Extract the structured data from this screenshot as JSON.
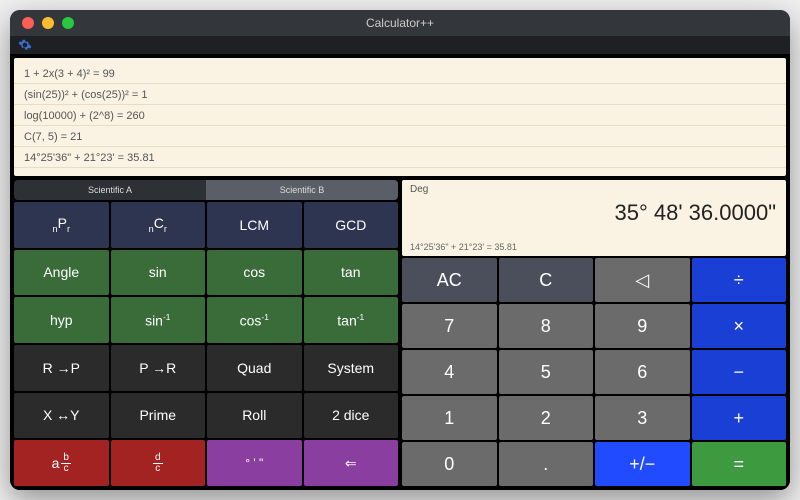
{
  "window": {
    "title": "Calculator++"
  },
  "history": [
    "1 + 2x(3 + 4)² = 99",
    "(sin(25))² + (cos(25))² = 1",
    "log(10000) + (2^8) = 260",
    "C(7, 5) = 21",
    "14°25'36\" + 21°23' = 35.81"
  ],
  "tabs": {
    "a": "Scientific A",
    "b": "Scientific B",
    "active": "b"
  },
  "sci": {
    "npr": "nPr",
    "ncr": "nCr",
    "lcm": "LCM",
    "gcd": "GCD",
    "angle": "Angle",
    "sin": "sin",
    "cos": "cos",
    "tan": "tan",
    "hyp": "hyp",
    "asin": "sin⁻¹",
    "acos": "cos⁻¹",
    "atan": "tan⁻¹",
    "rtop": "R →P",
    "ptor": "P →R",
    "quad": "Quad",
    "system": "System",
    "xy": "X ↔Y",
    "prime": "Prime",
    "roll": "Roll",
    "dice": "2 dice",
    "abc": "a b/c",
    "dc": "d/c",
    "dms": "° ' \"",
    "back": "⇐"
  },
  "display": {
    "mode": "Deg",
    "value": "35° 48' 36.0000\"",
    "expr": "14°25'36\" + 21°23' = 35.81"
  },
  "num": {
    "ac": "AC",
    "c": "C",
    "del": "◁",
    "div": "÷",
    "7": "7",
    "8": "8",
    "9": "9",
    "mul": "×",
    "4": "4",
    "5": "5",
    "6": "6",
    "sub": "−",
    "1": "1",
    "2": "2",
    "3": "3",
    "add": "+",
    "0": "0",
    "dot": ".",
    "neg": "+/−",
    "eq": "="
  },
  "colors": {
    "navy": "#2d3550",
    "green": "#396c39",
    "dark": "#2b2b2b",
    "red": "#a32222",
    "purple": "#8a3fa0",
    "slate": "#4a4f5b",
    "gray": "#6b6b6b",
    "blue": "#1a3fd4",
    "eq": "#3e9a3e"
  }
}
